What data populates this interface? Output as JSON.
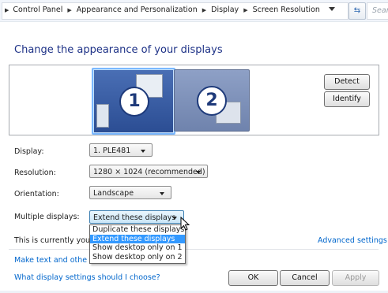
{
  "address_bar": {
    "breadcrumbs": [
      "Control Panel",
      "Appearance and Personalization",
      "Display",
      "Screen Resolution"
    ],
    "search_placeholder": "Search Control Panel",
    "refresh_glyph": "⇆",
    "separator_glyph": "▶"
  },
  "page": {
    "title": "Change the appearance of your displays"
  },
  "monitors": [
    {
      "number": "1",
      "selected": true
    },
    {
      "number": "2",
      "selected": false
    }
  ],
  "buttons": {
    "detect": "Detect",
    "identify": "Identify",
    "ok": "OK",
    "cancel": "Cancel",
    "apply": "Apply"
  },
  "settings": {
    "display_label": "Display:",
    "display_value": "1. PLE481",
    "resolution_label": "Resolution:",
    "resolution_value": "1280 × 1024 (recommended)",
    "orientation_label": "Orientation:",
    "orientation_value": "Landscape",
    "multiple_label": "Multiple displays:",
    "multiple_value": "Extend these displays",
    "multiple_options": [
      "Duplicate these displays",
      "Extend these displays",
      "Show desktop only on 1",
      "Show desktop only on 2"
    ],
    "multiple_selected_index": 1
  },
  "status_text": "This is currently you",
  "links": {
    "advanced": "Advanced settings",
    "make_text": "Make text and othe",
    "which_settings": "What display settings should I choose?"
  },
  "colors": {
    "title": "#1e3287",
    "link": "#0066cc",
    "selection": "#3399ff"
  }
}
